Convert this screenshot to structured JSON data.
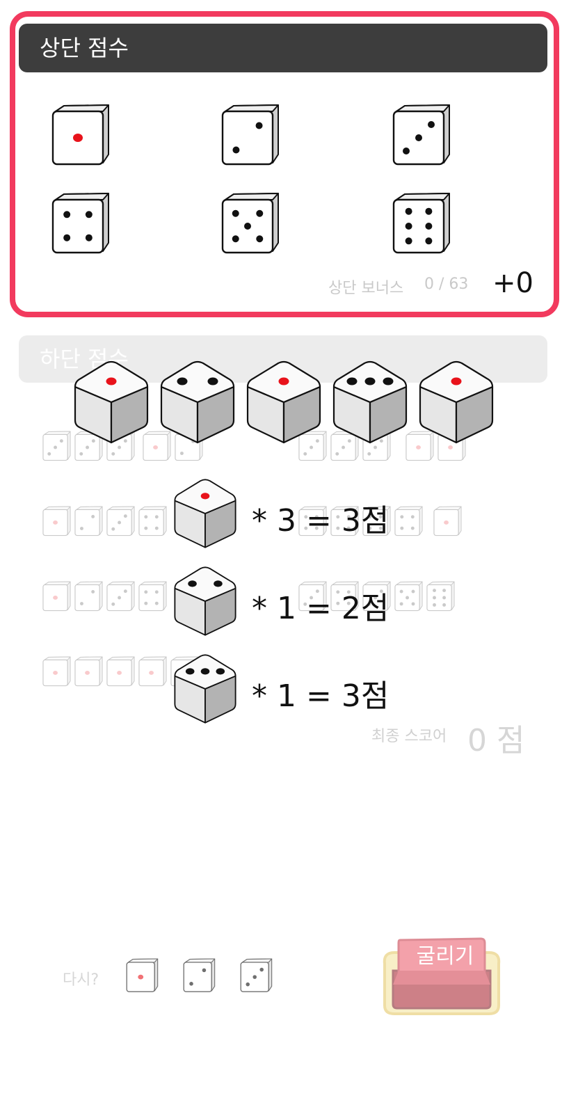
{
  "upper": {
    "title": "상단 점수",
    "faces": [
      {
        "name": "ones",
        "value": 1
      },
      {
        "name": "twos",
        "value": 2
      },
      {
        "name": "threes",
        "value": 3
      },
      {
        "name": "fours",
        "value": 4
      },
      {
        "name": "fives",
        "value": 5
      },
      {
        "name": "sixes",
        "value": 6
      }
    ],
    "bonus_label": "상단 보너스",
    "bonus_progress": "0 / 63",
    "bonus_points": "+0"
  },
  "lower": {
    "title": "하단 점수"
  },
  "rolled_dice": [
    1,
    2,
    1,
    3,
    1
  ],
  "tally": [
    {
      "face": 1,
      "text": "* 3 = 3점"
    },
    {
      "face": 2,
      "text": "* 1 = 2점"
    },
    {
      "face": 3,
      "text": "* 1 = 3점"
    }
  ],
  "final": {
    "label": "최종 스코어",
    "value": "0 점"
  },
  "retry": {
    "label": "다시?",
    "dice": [
      1,
      2,
      3
    ]
  },
  "roll_button": {
    "label": "굴리기"
  },
  "colors": {
    "accent": "#f23a5e",
    "header_dark": "#3d3d3d",
    "pip_red": "#e8131b",
    "die_side": "#b3b3b3"
  }
}
